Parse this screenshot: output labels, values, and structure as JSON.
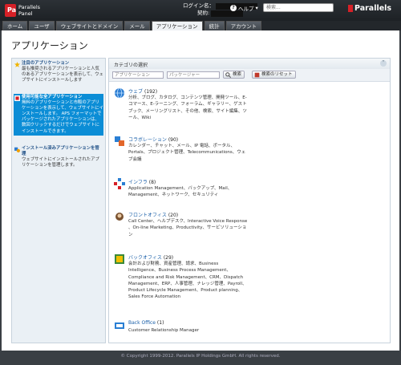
{
  "header": {
    "logo_line1": "Parallels",
    "logo_line2": "Panel",
    "logo_letter": "Pa",
    "login_label": "ログイン名：",
    "contract_label": "契約:",
    "help_label": "ヘルプ",
    "search_placeholder": "検索...",
    "brand": "Parallels"
  },
  "tabs": [
    "ホーム",
    "ユーザ",
    "ウェブサイトとドメイン",
    "メール",
    "アプリケーション",
    "統計",
    "アカウント"
  ],
  "active_tab": 4,
  "page_title": "アプリケーション",
  "sidebar": {
    "items": [
      {
        "title": "注目のアプリケーション",
        "desc": "最も推奨されるアプリケーションと人気のあるアプリケーションを表示して、ウェブサイトにインストールします"
      },
      {
        "title": "使用可能な全アプリケーション",
        "desc": "無料のアプリケーションと市販のアプリケーションを表示して、ウェブサイトにインストールします。 APS フォーマットでパッケージされたアプリケーションは、数回クリックするだけでウェブサイトにインストールできます。"
      },
      {
        "title": "インストール済みアプリケーションを管理",
        "desc": "ウェブサイトにインストールされたアプリケーションを管理します。"
      }
    ]
  },
  "main": {
    "header_label": "カテゴリの選択",
    "filter": {
      "app_placeholder": "アプリケーション",
      "packager_placeholder": "パッケージャー",
      "search_button": "検索",
      "reset_button": "検索のリセット"
    },
    "categories": [
      {
        "name": "ウェブ",
        "count": "(192)",
        "desc": "分析、ブログ、カタログ、コンテンツ管理、開発ツール、E-コマース、E-ラーニング、フォーラム、ギャラリー、ゲストブック、メーリングリスト、その他、検索、サイト編集、ツール、Wiki"
      },
      {
        "name": "コラボレーション",
        "count": "(90)",
        "desc": "カレンダー、チャット、メール、IP 電話、ポータル、Portals、プロジェクト管理、Telecommunications、ウェブ会議"
      },
      {
        "name": "インフラ",
        "count": "(8)",
        "desc": "Application Management、バックアップ、Mail、Management、ネットワーク、セキュリティ"
      },
      {
        "name": "フロントオフィス",
        "count": "(20)",
        "desc": "Call Center、ヘルプデスク、Interactive Voice Response 、On-line Marketing、Productivity、サービソリューション"
      },
      {
        "name": "バックオフィス",
        "count": "(29)",
        "desc": "会計および財務、資産管理、請求、Business Intelligence、Business Process Management、Compliance and Risk Management、CRM、Dispatch Management、ERP、人事管理、ナレッジ管理、Payroll、Product Lifecycle Management、Product planning、Sales Force Automation"
      },
      {
        "name": "Back Office",
        "count": "(1)",
        "desc": "Customer Relationship Manager"
      }
    ]
  },
  "footer": "© Copyright 1999-2012. Parallels IP Holdings GmbH. All rights reserved.",
  "colors": {
    "accent": "#0b8dd6",
    "brand_red": "#d62027",
    "link": "#1a5fa8"
  }
}
